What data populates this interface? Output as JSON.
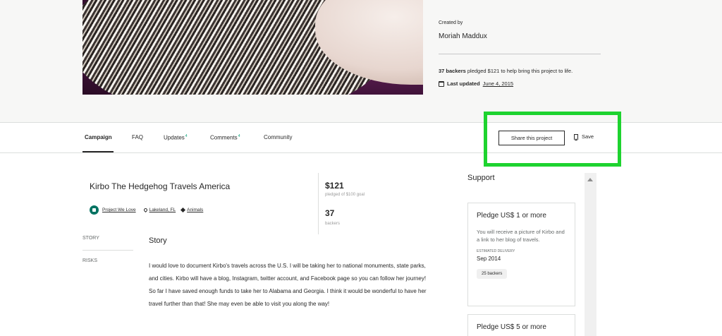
{
  "hero": {
    "image_alt": "hedgehog photo",
    "created_by_label": "Created by",
    "creator_name": "Moriah Maddux",
    "backers_bold": "37 backers",
    "backers_rest": " pledged $121 to help bring this project to life.",
    "last_updated_label": "Last updated",
    "last_updated_date": "June 4, 2015"
  },
  "nav": {
    "tabs": [
      {
        "label": "Campaign"
      },
      {
        "label": "FAQ"
      },
      {
        "label": "Updates",
        "count": "4"
      },
      {
        "label": "Comments",
        "count": "4"
      },
      {
        "label": "Community"
      }
    ],
    "share_label": "Share this project",
    "save_label": "Save"
  },
  "project": {
    "title": "Kirbo The Hedgehog Travels America",
    "badge_label": "Project We Love",
    "location": "Lakeland, FL",
    "category": "Animals",
    "pledged": "$121",
    "pledged_label": "pledged of $100 goal",
    "backers": "37",
    "backers_label": "backers"
  },
  "toc": {
    "story": "STORY",
    "risks": "RISKS"
  },
  "story": {
    "heading": "Story",
    "body": "I would love to document Kirbo's travels across the U.S. I will be taking her to national monuments, state parks, and cities. Kirbo will have a blog, Instagram, twitter account, and Facebook page so you can follow her journey! So far I have saved enough funds to take her to Alabama and Georgia. I think it would be wonderful to have her travel further than that! She may even be able to visit you along the way!"
  },
  "support": {
    "heading": "Support",
    "rewards": [
      {
        "title": "Pledge US$ 1 or more",
        "description": "You will receive a picture of Kirbo and a link to her blog of travels.",
        "delivery_label": "ESTIMATED DELIVERY",
        "delivery": "Sep 2014",
        "backers": "25 backers"
      },
      {
        "title": "Pledge US$ 5 or more"
      }
    ]
  },
  "colors": {
    "highlight": "#1ed32f",
    "accent_green": "#009e74",
    "badge_green": "#037362"
  }
}
